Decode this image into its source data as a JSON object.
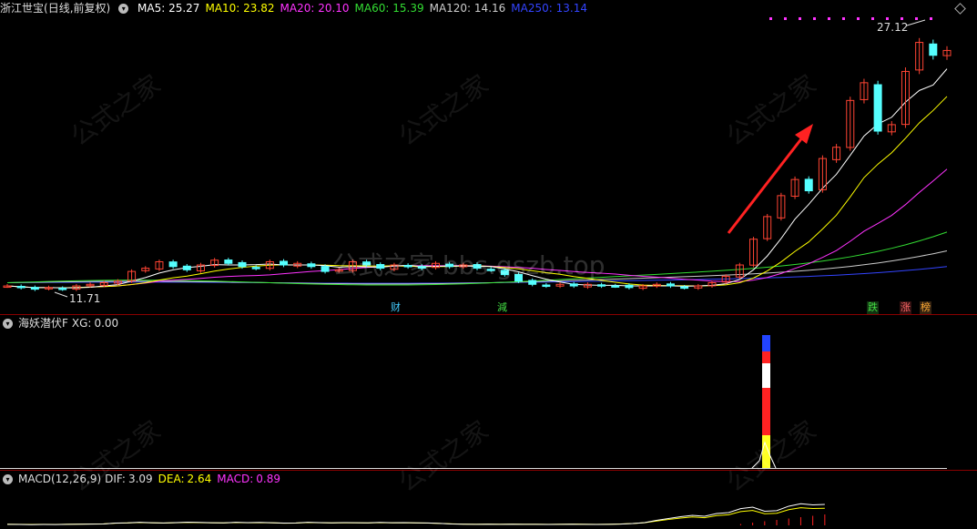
{
  "header": {
    "title": "浙江世宝",
    "mode": "(日线,前复权)",
    "ma": [
      {
        "label": "MA5:",
        "value": "25.27",
        "color": "#ffffff"
      },
      {
        "label": "MA10:",
        "value": "23.82",
        "color": "#ffff00"
      },
      {
        "label": "MA20:",
        "value": "20.10",
        "color": "#ff33ff"
      },
      {
        "label": "MA60:",
        "value": "15.39",
        "color": "#33dd33"
      },
      {
        "label": "MA120:",
        "value": "14.16",
        "color": "#cccccc"
      },
      {
        "label": "MA250:",
        "value": "13.14",
        "color": "#3344ff"
      }
    ]
  },
  "price_labels": {
    "high": "27.12",
    "low": "11.71"
  },
  "events": [
    {
      "text": "财",
      "color": "#44ccff",
      "bg": "#000"
    },
    {
      "text": "減",
      "color": "#44dd44",
      "bg": "#000"
    },
    {
      "text": "跌",
      "color": "#44dd44",
      "bg": "#113311"
    },
    {
      "text": "涨",
      "color": "#ff6666",
      "bg": "#331111"
    },
    {
      "text": "榜",
      "color": "#ffaa33",
      "bg": "#332211"
    }
  ],
  "indicator": {
    "name": "海妖潜伏F",
    "xg_label": "XG:",
    "xg_value": "0.00"
  },
  "macd": {
    "name": "MACD(12,26,9)",
    "dif_label": "DIF:",
    "dif_value": "3.09",
    "dea_label": "DEA:",
    "dea_value": "2.64",
    "macd_label": "MACD:",
    "macd_value": "0.89"
  },
  "watermark": {
    "text": "公式之家 bbs.gszb.top",
    "diag": "公式之家",
    "diag_url": "www.gszj100.com"
  },
  "colors": {
    "up": "#ff4433",
    "down": "#55ffff",
    "arrow": "#ff2222",
    "separator": "#8a0000"
  },
  "chart_data": {
    "type": "candlestick",
    "close": [
      11.9,
      11.8,
      11.7,
      11.8,
      11.71,
      11.9,
      12.0,
      12.1,
      12.2,
      12.8,
      13.0,
      13.4,
      13.1,
      12.9,
      13.2,
      13.5,
      13.3,
      13.1,
      13.0,
      13.4,
      13.2,
      13.3,
      13.1,
      12.8,
      12.9,
      13.4,
      13.2,
      13.0,
      13.2,
      13.1,
      13.0,
      13.3,
      13.1,
      13.2,
      13.0,
      12.9,
      12.6,
      12.2,
      12.0,
      11.9,
      12.0,
      11.9,
      12.0,
      11.9,
      11.9,
      11.8,
      11.9,
      12.0,
      11.9,
      11.8,
      11.9,
      12.1,
      12.5,
      13.2,
      14.8,
      16.2,
      17.5,
      18.5,
      17.8,
      19.8,
      20.5,
      23.4,
      24.5,
      21.5,
      21.9,
      25.2,
      27.0,
      26.2,
      26.5
    ],
    "ma_values": {
      "MA5": 25.27,
      "MA10": 23.82,
      "MA20": 20.1,
      "MA60": 15.39,
      "MA120": 14.16,
      "MA250": 13.14
    },
    "ylim": [
      11.0,
      28.5
    ]
  }
}
